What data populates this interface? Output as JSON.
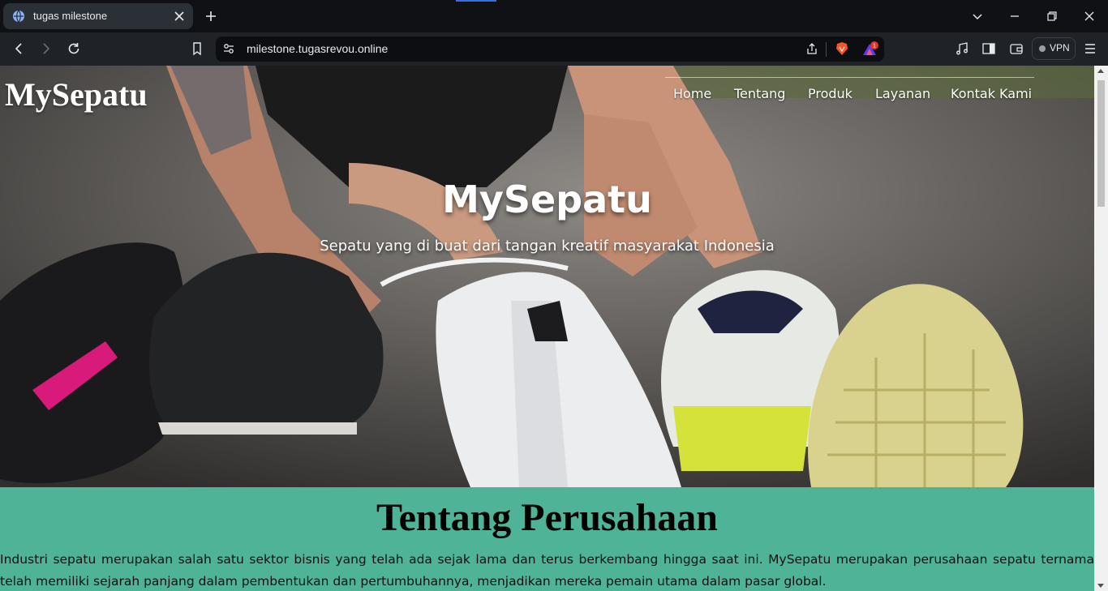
{
  "browser": {
    "tab_title": "tugas milestone",
    "url": "milestone.tugasrevou.online",
    "vpn_label": "VPN",
    "rewards_badge": "1",
    "colors": {
      "tabbar": "#0f1115",
      "toolbar": "#1f2227",
      "urlbar": "#0c0e11",
      "accent": "#3c6de0"
    }
  },
  "site": {
    "logo": "MySepatu",
    "nav": [
      "Home",
      "Tentang",
      "Produk",
      "Layanan",
      "Kontak Kami"
    ],
    "hero": {
      "title": "MySepatu",
      "subtitle": "Sepatu yang di buat dari tangan kreatif masyarakat Indonesia"
    },
    "about": {
      "title": "Tentang Perusahaan",
      "text": "Industri sepatu merupakan salah satu sektor bisnis yang telah ada sejak lama dan terus berkembang hingga saat ini. MySepatu merupakan perusahaan sepatu ternama telah memiliki sejarah panjang dalam pembentukan dan pertumbuhannya, menjadikan mereka pemain utama dalam pasar global."
    },
    "colors": {
      "section_bg": "#4fb497",
      "text_light": "#ffffff",
      "text_dark": "#000000"
    }
  }
}
